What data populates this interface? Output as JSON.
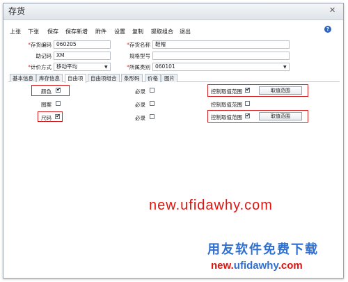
{
  "window": {
    "title": "存货",
    "close": "✕"
  },
  "toolbar": {
    "items": [
      "上张",
      "下张",
      "保存",
      "保存新增",
      "附件",
      "设置",
      "复制",
      "提取组合",
      "退出"
    ],
    "help": "?"
  },
  "form": {
    "code_label": "存货编码",
    "code_value": "060205",
    "name_label": "存货名称",
    "name_value": "鞋帽",
    "mnemonic_label": "助记码",
    "mnemonic_value": "XM",
    "spec_label": "规格型号",
    "spec_value": "",
    "pricing_label": "计价方式",
    "pricing_value": "移动平均",
    "category_label": "所属类别",
    "category_value": "060101"
  },
  "tabs": [
    "基本信息",
    "库存信息",
    "自由项",
    "自由项组合",
    "条形码",
    "价格",
    "图片"
  ],
  "active_tab": "自由项",
  "free_items": [
    {
      "label": "颜色",
      "checked": true,
      "required_label": "必录",
      "required": false,
      "range_label": "控制取值范围",
      "range_checked": true,
      "button": "取值范围"
    },
    {
      "label": "图案",
      "checked": false,
      "required_label": "必录",
      "required": false,
      "range_label": "控制取值范围",
      "range_checked": false,
      "button": ""
    },
    {
      "label": "尺码",
      "checked": true,
      "required_label": "必录",
      "required": false,
      "range_label": "控制取值范围",
      "range_checked": true,
      "button": "取值范围"
    }
  ],
  "watermark": {
    "url1": "new.ufidawhy.com",
    "cn": "用友软件免费下载",
    "url2_a": "new.",
    "url2_b": "ufidawhy",
    "url2_c": ".com"
  },
  "colors": {
    "highlight": "#d21e1e",
    "watermark_red": "#e0140e",
    "watermark_blue": "#2f6fd0"
  }
}
